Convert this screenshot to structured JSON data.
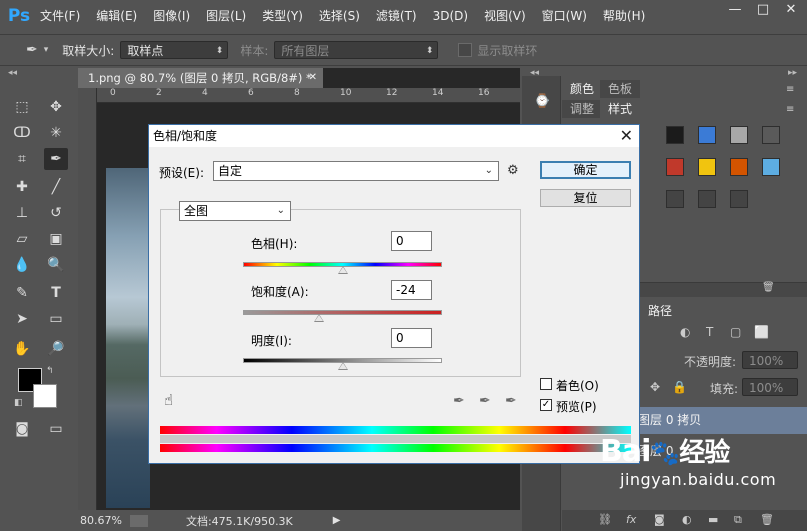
{
  "app": {
    "logo": "Ps",
    "accent": "#31a8ff"
  },
  "menu": [
    "文件(F)",
    "编辑(E)",
    "图像(I)",
    "图层(L)",
    "类型(Y)",
    "选择(S)",
    "滤镜(T)",
    "3D(D)",
    "视图(V)",
    "窗口(W)",
    "帮助(H)"
  ],
  "window_controls": {
    "minimize": "—",
    "maximize": "□",
    "close": "✕"
  },
  "options": {
    "sample_size_label": "取样大小:",
    "sample_size_value": "取样点",
    "sample_label": "样本:",
    "sample_value": "所有图层",
    "show_ring_label": "显示取样环"
  },
  "document": {
    "tab_title": "1.png @ 80.7% (图层 0 拷贝, RGB/8#) *",
    "ruler_numbers": [
      "0",
      "2",
      "4",
      "6",
      "8",
      "10",
      "12",
      "14",
      "16"
    ],
    "zoom": "80.67%",
    "doc_size": "文档:475.1K/950.3K"
  },
  "panels": {
    "color_tab": "颜色",
    "swatches_tab": "色板",
    "adjust_tab": "调整",
    "styles_tab": "样式",
    "paths_tab": "路径",
    "opacity_label": "不透明度:",
    "opacity_value": "100%",
    "fill_label": "填充:",
    "fill_value": "100%",
    "layer_selected": "图层 0 拷贝",
    "layer_other": "图层 0"
  },
  "dialog": {
    "title": "色相/饱和度",
    "preset_label": "预设(E):",
    "preset_value": "自定",
    "ok_label": "确定",
    "reset_label": "复位",
    "channel_value": "全图",
    "hue_label": "色相(H):",
    "hue_value": "0",
    "saturation_label": "饱和度(A):",
    "saturation_value": "-24",
    "lightness_label": "明度(I):",
    "lightness_value": "0",
    "colorize_label": "着色(O)",
    "colorize_checked": false,
    "preview_label": "预览(P)",
    "preview_checked": true,
    "sliders": {
      "hue": 0,
      "saturation": -24,
      "lightness": 0
    }
  },
  "watermark": {
    "brand": "Bai",
    "brand_tail": "经验",
    "url": "jingyan.baidu.com"
  }
}
